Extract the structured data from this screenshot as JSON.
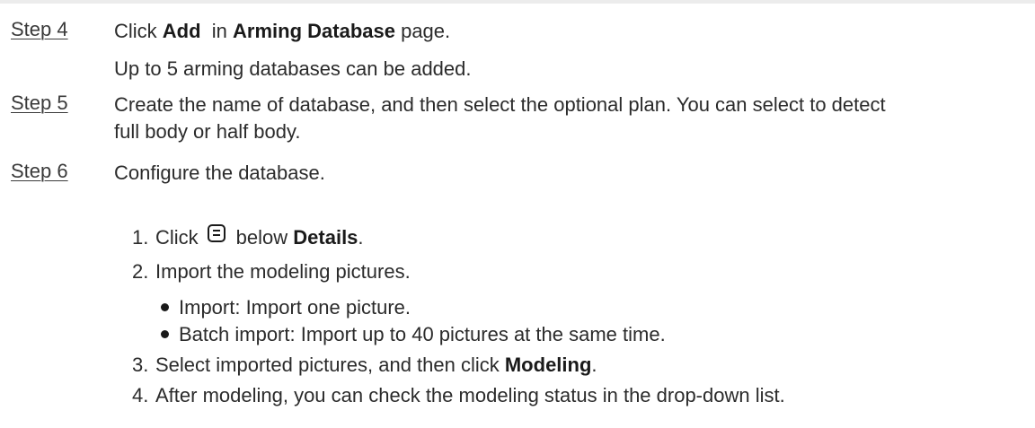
{
  "step4": {
    "label": "Step 4",
    "text_pre": "Click ",
    "bold1": "Add",
    "text_mid": "  in ",
    "bold2": "Arming Database",
    "text_post": " page.",
    "note": "Up to 5 arming databases can be added."
  },
  "step5": {
    "label": "Step 5",
    "line1": "Create the name of database, and then select the optional plan. You can select to detect",
    "line2": "full body or half body."
  },
  "step6": {
    "label": "Step 6",
    "text": "Configure the database.",
    "sub": [
      {
        "num": "1.",
        "pre": "Click",
        "icon": "details-list-icon",
        "mid": "below ",
        "bold": "Details",
        "post": "."
      },
      {
        "num": "2.",
        "text": "Import the modeling pictures."
      },
      {
        "num": "3.",
        "pre": "Select imported pictures, and then click ",
        "bold": "Modeling",
        "post": "."
      },
      {
        "num": "4.",
        "text": "After modeling, you can check the modeling status in the drop-down list."
      }
    ],
    "bullets": [
      "Import: Import one picture.",
      "Batch import: Import up to 40 pictures at the same time."
    ]
  }
}
